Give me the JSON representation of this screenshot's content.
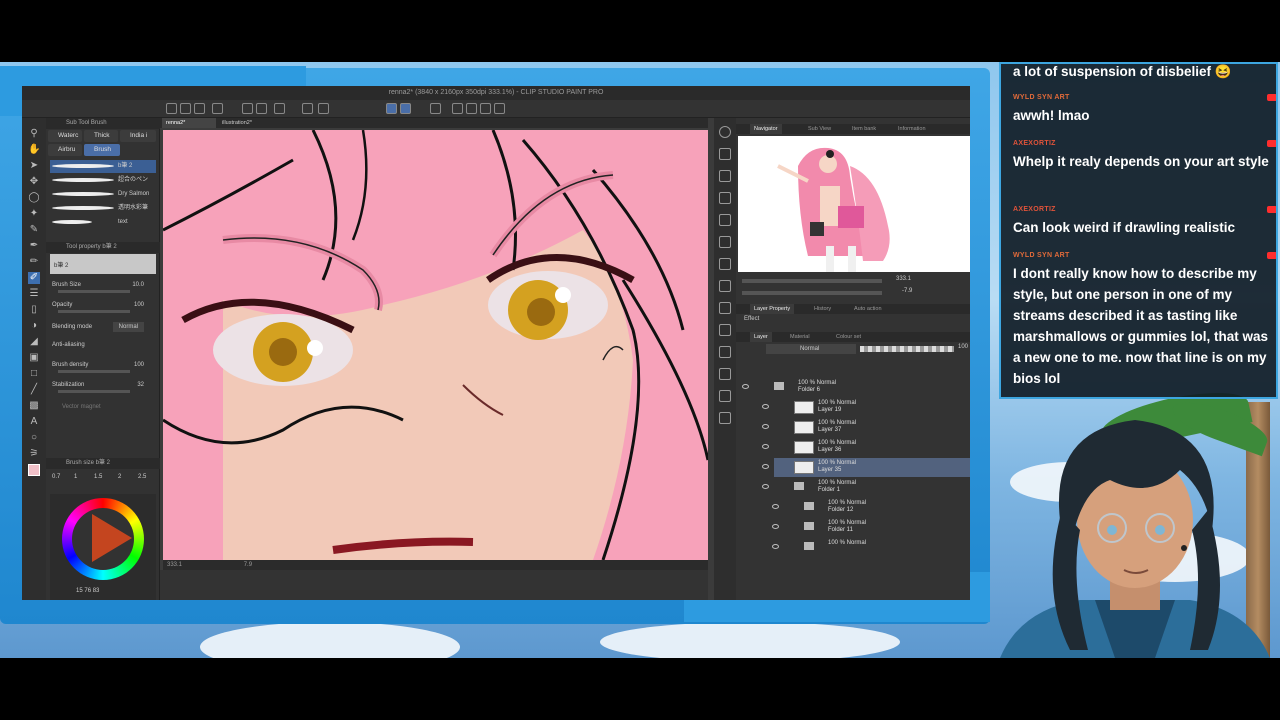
{
  "window": {
    "title": "renna2* (3840 x 2160px 350dpi 333.1%) - CLIP STUDIO PAINT PRO"
  },
  "subtool_panel": {
    "header": "Sub Tool Brush",
    "tabs": [
      {
        "label": "Waterc",
        "selected": false
      },
      {
        "label": "Thick",
        "selected": false
      },
      {
        "label": "India i",
        "selected": false
      },
      {
        "label": "Airbru",
        "selected": false
      },
      {
        "label": "Brush",
        "selected": true
      }
    ],
    "brushes": [
      {
        "name": "b筆 2",
        "selected": true
      },
      {
        "name": "超合のペン",
        "selected": false
      },
      {
        "name": "Dry Salmon",
        "selected": false
      },
      {
        "name": "透明水彩筆",
        "selected": false
      },
      {
        "name": "text",
        "selected": false
      }
    ]
  },
  "tool_property": {
    "header": "Tool property  b筆 2",
    "preview_label": "b筆 2",
    "brush_size": {
      "label": "Brush Size",
      "value": "10.0"
    },
    "opacity": {
      "label": "Opacity",
      "value": "100"
    },
    "blending_mode": {
      "label": "Blending mode",
      "value": "Normal"
    },
    "anti_aliasing": {
      "label": "Anti-aliasing"
    },
    "brush_density": {
      "label": "Brush density",
      "value": "100"
    },
    "stabilization": {
      "label": "Stabilization",
      "value": "32"
    },
    "vector_magnet": {
      "label": "Vector magnet"
    }
  },
  "brush_size_panel": {
    "header": "Brush size  b筆 2",
    "sizes": [
      "0.7",
      "1",
      "1.5",
      "2",
      "2.5"
    ]
  },
  "color": {
    "values": [
      "15",
      "76",
      "83"
    ]
  },
  "canvas": {
    "tabs": [
      {
        "label": "renna2*",
        "selected": true
      },
      {
        "label": "illustration2*",
        "selected": false
      }
    ],
    "status_zoom": "333.1",
    "status_angle": "7.9"
  },
  "navigator": {
    "tabs": [
      "Navigator",
      "Sub View",
      "Item bank",
      "Information"
    ],
    "zoom": "333.1",
    "angle": "-7.9"
  },
  "layer_property": {
    "tabs": [
      "Layer Property",
      "History",
      "Auto action"
    ],
    "effect_label": "Effect"
  },
  "layers": {
    "tabs": [
      "Layer",
      "Material",
      "Colour set"
    ],
    "blend_mode": "Normal",
    "opacity_value": "100",
    "items": [
      {
        "line1": "100 % Normal",
        "line2": "Folder 6",
        "type": "folder",
        "selected": false
      },
      {
        "line1": "100 % Normal",
        "line2": "Layer 19",
        "type": "layer",
        "selected": false
      },
      {
        "line1": "100 % Normal",
        "line2": "Layer 37",
        "type": "layer",
        "selected": false
      },
      {
        "line1": "100 % Normal",
        "line2": "Layer 36",
        "type": "layer",
        "selected": false
      },
      {
        "line1": "100 % Normal",
        "line2": "Layer 35",
        "type": "layer",
        "selected": true
      },
      {
        "line1": "100 % Normal",
        "line2": "Folder 1",
        "type": "folder",
        "selected": false
      },
      {
        "line1": "100 % Normal",
        "line2": "Folder 12",
        "type": "folder",
        "selected": false
      },
      {
        "line1": "100 % Normal",
        "line2": "Folder 11",
        "type": "folder",
        "selected": false
      },
      {
        "line1": "100 % Normal",
        "line2": "",
        "type": "folder",
        "selected": false
      }
    ]
  },
  "chat": {
    "messages": [
      {
        "user": "",
        "text": "a lot of suspension of disbelief 😆",
        "user_color": "#e06a3a"
      },
      {
        "user": "WYLD SYN ART",
        "text": "awwh! lmao",
        "user_color": "#e06a3a"
      },
      {
        "user": "AXEXORTIZ",
        "text": "Whelp it realy depends on your art style",
        "user_color": "#e0533a"
      },
      {
        "user": "AXEXORTIZ",
        "text": "Can look weird if drawling realistic",
        "user_color": "#e0533a"
      },
      {
        "user": "WYLD SYN ART",
        "text": "I dont really know how to describe my style, but one person in one of my streams described it as tasting like marshmallows or gummies lol, that was a new one to me. now that line is on my bios lol",
        "user_color": "#e06a3a"
      }
    ]
  },
  "colors": {
    "frame_blue": "#2d9be0",
    "canvas_pink": "#f7a2ba",
    "skin": "#f2c9b8",
    "eye_gold": "#d4a120",
    "youtube_red": "#ff2d2d"
  }
}
